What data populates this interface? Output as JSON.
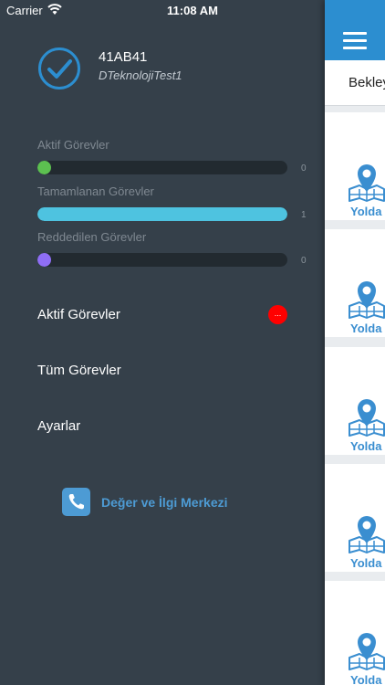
{
  "status_bar": {
    "carrier": "Carrier",
    "time": "11:08 AM"
  },
  "profile": {
    "name": "41AB41",
    "org": "DTeknolojiTest1",
    "check_color": "#2c8ed0"
  },
  "stats": [
    {
      "label": "Aktif Görevler",
      "count": "0",
      "fraction": 0.0,
      "color": "#5cc050"
    },
    {
      "label": "Tamamlanan Görevler",
      "count": "1",
      "fraction": 1.0,
      "color": "#4ec3e0"
    },
    {
      "label": "Reddedilen Görevler",
      "count": "0",
      "fraction": 0.0,
      "color": "#8f6ef5"
    }
  ],
  "menu": {
    "active_tasks": "Aktif Görevler",
    "active_badge": "...",
    "all_tasks": "Tüm Görevler",
    "settings": "Ayarlar"
  },
  "support": {
    "label": "Değer ve İlgi Merkezi"
  },
  "right_panel": {
    "tab_text": "Bekley",
    "accent": "#2c8ed0",
    "cards": [
      {
        "status": "Yolda"
      },
      {
        "status": "Yolda"
      },
      {
        "status": "Yolda"
      },
      {
        "status": "Yolda"
      },
      {
        "status": "Yolda"
      }
    ]
  }
}
